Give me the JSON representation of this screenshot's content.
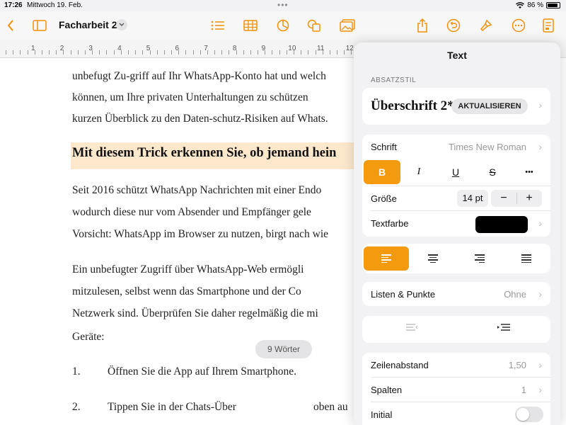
{
  "status": {
    "time": "17:26",
    "date": "Mittwoch 19. Feb.",
    "battery": "86 %",
    "battery_level": 0.86,
    "dots": "•••"
  },
  "toolbar": {
    "back_icon": "chevron-left-icon",
    "doc_title": "Facharbeit 2",
    "title_menu_icon": "chevron-down-icon"
  },
  "ruler": {
    "numbers": [
      "1",
      "2",
      "3",
      "4",
      "5",
      "6",
      "7",
      "8",
      "9",
      "10",
      "11",
      "12"
    ]
  },
  "document": {
    "para1": [
      "unbefugt Zu-griff auf Ihr WhatsApp-Konto hat und welch",
      "können, um Ihre privaten Unterhaltungen zu schützen",
      "kurzen Überblick zu den Daten-schutz-Risiken auf Whats."
    ],
    "heading": "Mit diesem Trick erkennen Sie, ob jemand hein",
    "para2": [
      "Seit 2016 schützt WhatsApp Nachrichten mit einer Endo",
      "wodurch diese nur vom Absender und Empfänger gele",
      "Vorsicht: WhatsApp im Browser zu nutzen, birgt nach wie"
    ],
    "para3": [
      "Ein unbefugter Zugriff über WhatsApp-Web ermögli",
      "mitzulesen, selbst wenn das Smartphone und der Co",
      "Netzwerk sind. Überprüfen Sie daher regelmäßig die mi",
      "Geräte:"
    ],
    "list": [
      {
        "num": "1.",
        "text": "Öffnen Sie die App auf Ihrem Smartphone."
      },
      {
        "num": "2.",
        "text": "Tippen Sie in der Chats-Über"
      }
    ],
    "list2_tail": "oben au",
    "word_count": "9 Wörter"
  },
  "panel": {
    "title": "Text",
    "section": "ABSATZSTIL",
    "paragraph_style": "Überschrift 2*",
    "update_label": "AKTUALISIEREN",
    "font_label": "Schrift",
    "font_value": "Times New Roman",
    "bold": "B",
    "italic": "I",
    "underline": "U",
    "strike": "S",
    "more": "•••",
    "size_label": "Größe",
    "size_value": "14 pt",
    "minus": "−",
    "plus": "+",
    "color_label": "Textfarbe",
    "text_color": "#000000",
    "lists_label": "Listen & Punkte",
    "lists_value": "Ohne",
    "line_spacing_label": "Zeilenabstand",
    "line_spacing_value": "1,50",
    "columns_label": "Spalten",
    "columns_value": "1",
    "initial_label": "Initial",
    "chevron": "›"
  },
  "colors": {
    "accent": "#f49a0e",
    "heading_highlight": "#fde8cc"
  }
}
